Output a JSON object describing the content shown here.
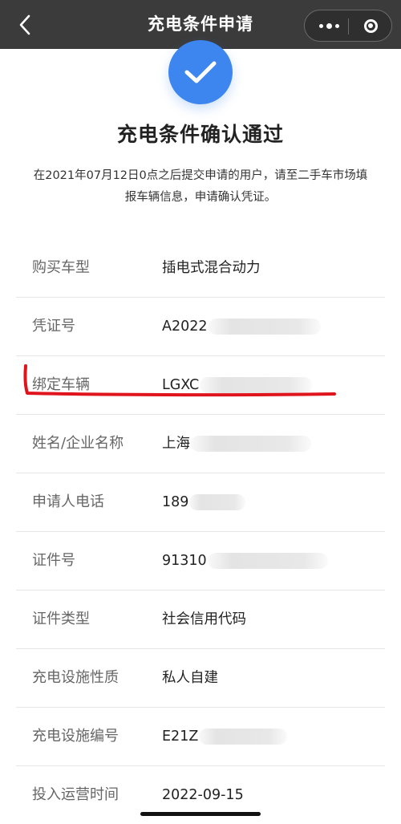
{
  "nav": {
    "title": "充电条件申请",
    "back_icon": "chevron-left-icon",
    "more_icon": "more-dots-icon",
    "close_icon": "target-circle-icon"
  },
  "result": {
    "icon": "checkmark-icon",
    "heading": "充电条件确认通过",
    "description": "在2021年07月12日0点之后提交申请的用户，请至二手车市场填报车辆信息，申请确认凭证。"
  },
  "details": [
    {
      "label": "购买车型",
      "value": "插电式混合动力",
      "redacted": false
    },
    {
      "label": "凭证号",
      "value": "A2022",
      "redacted": true
    },
    {
      "label": "绑定车辆",
      "value": "LGXC",
      "redacted": true
    },
    {
      "label": "姓名/企业名称",
      "value": "上海",
      "redacted": true
    },
    {
      "label": "申请人电话",
      "value": "189",
      "redacted": true
    },
    {
      "label": "证件号",
      "value": "91310",
      "redacted": true
    },
    {
      "label": "证件类型",
      "value": "社会信用代码",
      "redacted": false
    },
    {
      "label": "充电设施性质",
      "value": "私人自建",
      "redacted": false
    },
    {
      "label": "充电设施编号",
      "value": "E21Z",
      "redacted": true
    },
    {
      "label": "投入运营时间",
      "value": "2022-09-15",
      "redacted": false
    }
  ],
  "colors": {
    "nav_bg": "#3b3b3b",
    "accent": "#3d86f0",
    "annotation": "#e0141c"
  }
}
